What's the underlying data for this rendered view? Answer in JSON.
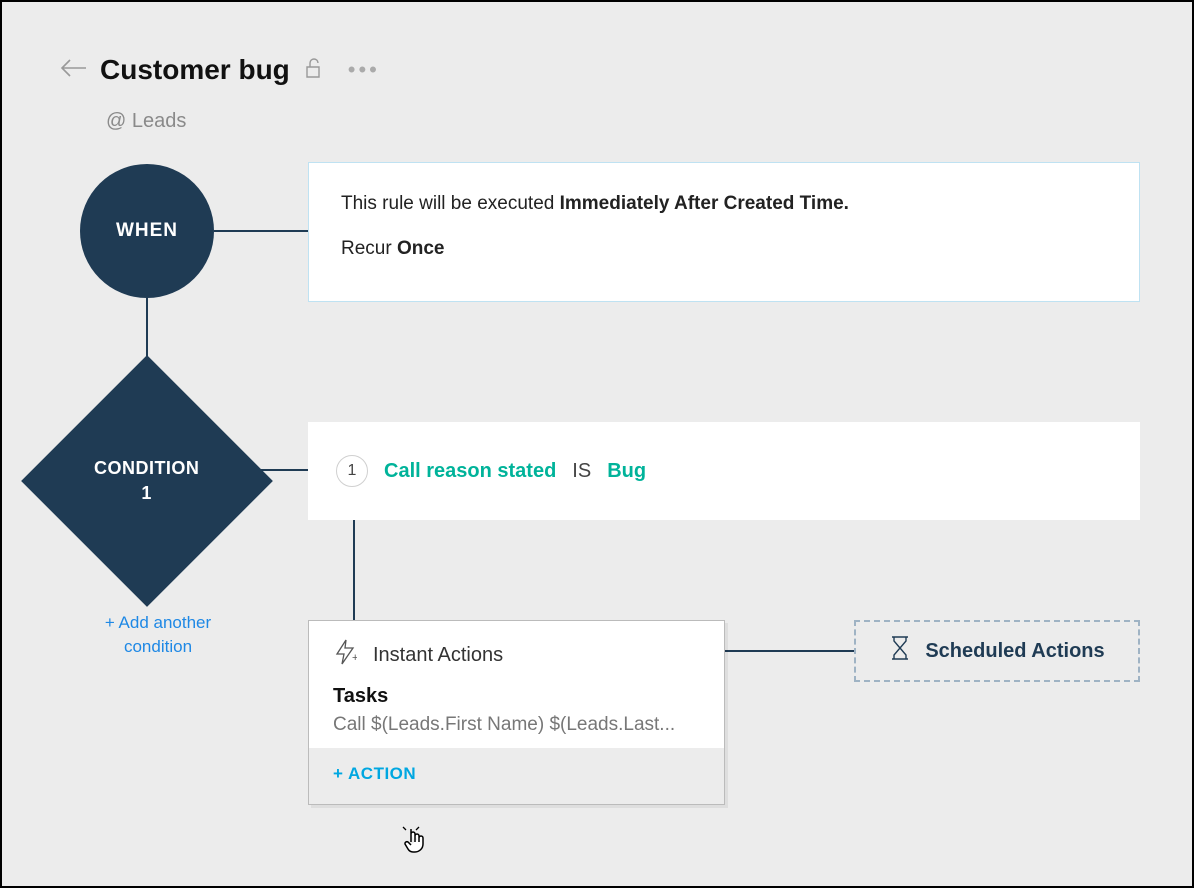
{
  "header": {
    "title": "Customer bug",
    "context": "@ Leads"
  },
  "when": {
    "node_label": "WHEN",
    "rule_prefix": "This rule will be executed ",
    "rule_timing": "Immediately After Created Time.",
    "recur_prefix": "Recur ",
    "recur_value": "Once"
  },
  "condition": {
    "node_label_line1": "CONDITION",
    "node_label_line2": "1",
    "number": "1",
    "field": "Call reason stated",
    "operator": "IS",
    "value": "Bug",
    "add_another": "+ Add another condition"
  },
  "instant": {
    "title": "Instant Actions",
    "tasks_label": "Tasks",
    "task_item": "Call $(Leads.First Name) $(Leads.Last...",
    "add_action": "+ ACTION"
  },
  "scheduled": {
    "label": "Scheduled Actions"
  }
}
